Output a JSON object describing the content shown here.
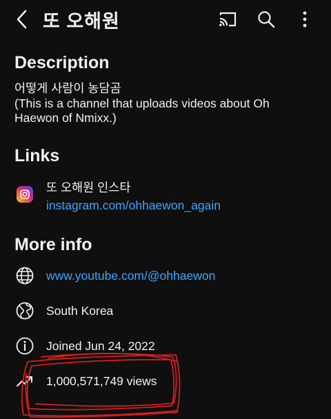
{
  "header": {
    "title": "또 오해원"
  },
  "description": {
    "heading": "Description",
    "lines": [
      "어떻게 사람이 농담곰",
      "(This is a channel that uploads videos about Oh",
      "Haewon of Nmixx.)"
    ]
  },
  "links": {
    "heading": "Links",
    "items": [
      {
        "title": "또 오해원 인스타",
        "url": "instagram.com/ohhaewon_again",
        "icon": "instagram-icon"
      }
    ]
  },
  "more_info": {
    "heading": "More info",
    "website": "www.youtube.com/@ohhaewon",
    "country": "South Korea",
    "joined": "Joined Jun 24, 2022",
    "views": "1,000,571,749 views"
  },
  "colors": {
    "background": "#0f0f0f",
    "text": "#f1f1f1",
    "link": "#3ea6ff",
    "annotation": "#e0201c"
  }
}
